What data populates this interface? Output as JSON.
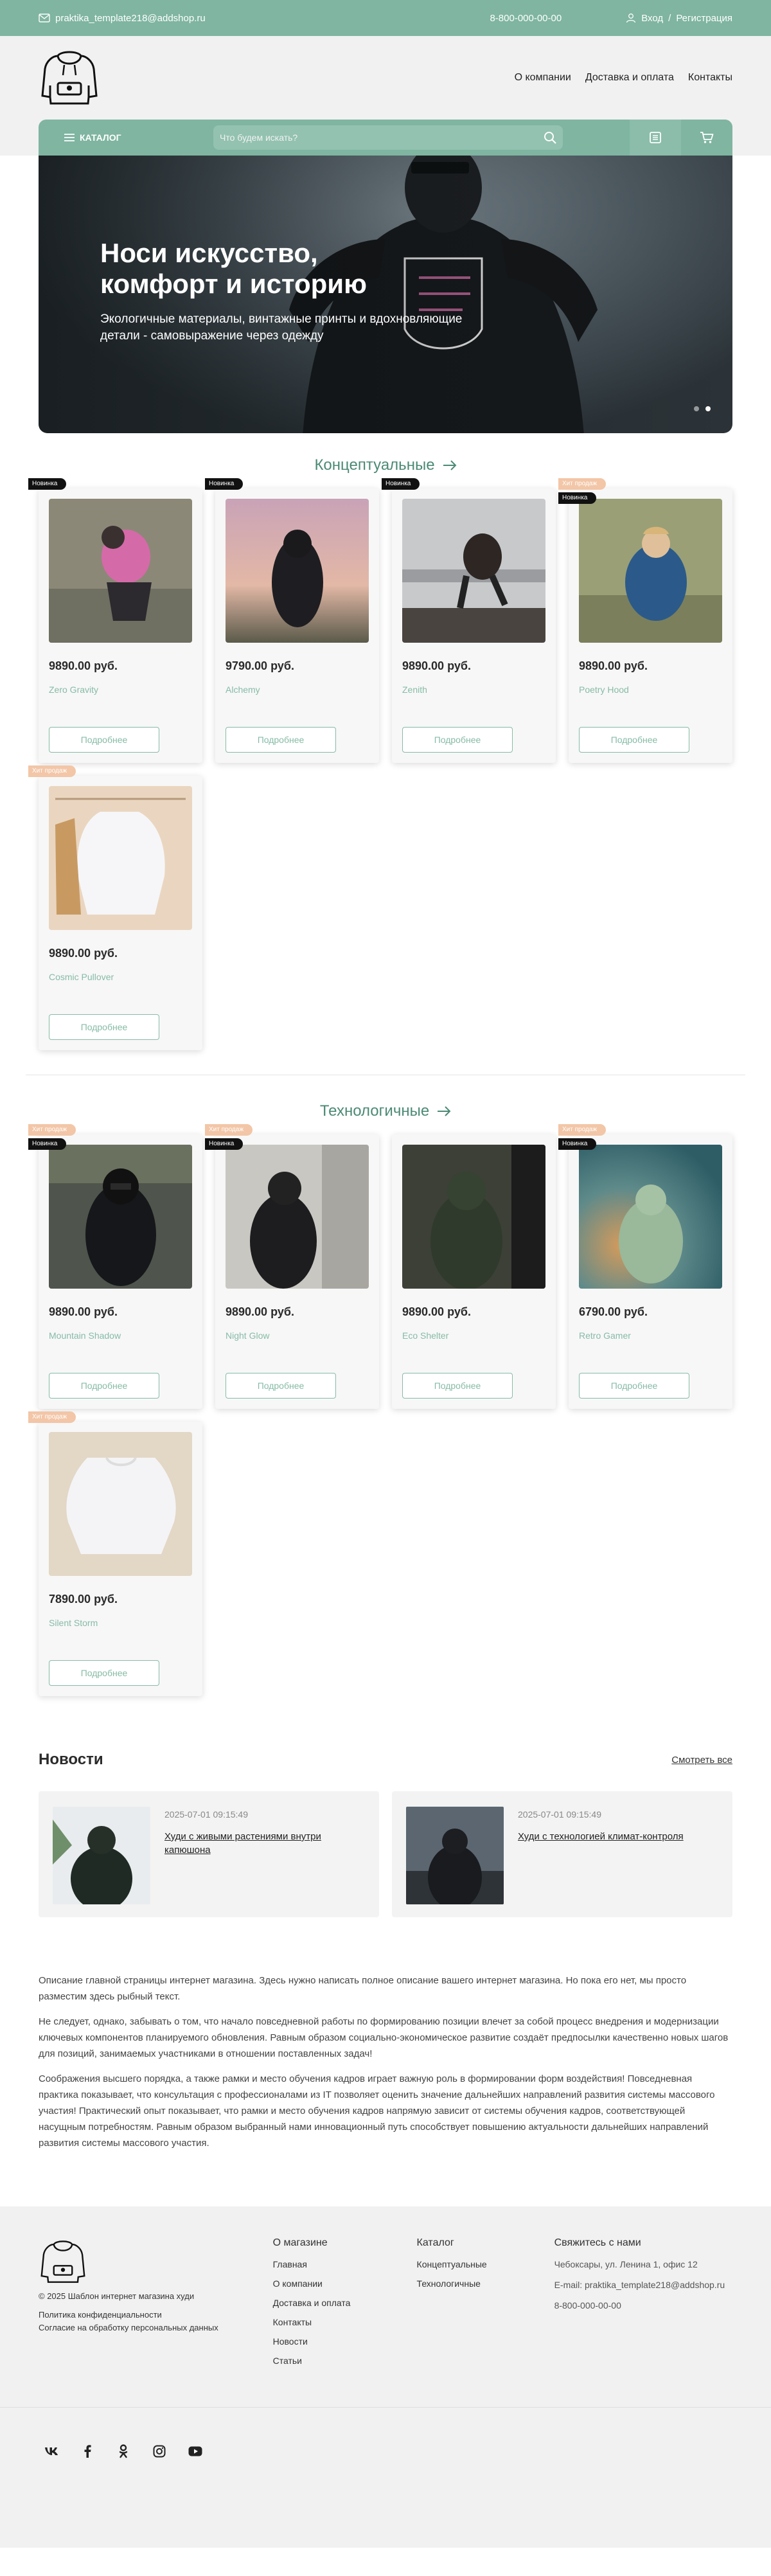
{
  "topbar": {
    "email": "praktika_template218@addshop.ru",
    "phone": "8-800-000-00-00",
    "login": "Вход",
    "separator": "/",
    "register": "Регистрация",
    "bg_color": "#7fb5a1"
  },
  "header": {
    "nav": [
      "О компании",
      "Доставка и оплата",
      "Контакты"
    ]
  },
  "catalog_bar": {
    "catalog_label": "КАТАЛОГ",
    "search_placeholder": "Что будем искать?",
    "icons": [
      "menu-icon",
      "search-icon",
      "compare-icon",
      "cart-icon"
    ]
  },
  "hero": {
    "title": "Носи искусство, комфорт и историю",
    "subtitle": "Экологичные материалы, винтажные принты и вдохновляющие детали - самовыражение через одежду"
  },
  "sections": [
    {
      "title": "Концептуальные",
      "products": [
        {
          "price": "9890.00 руб.",
          "name": "Zero Gravity",
          "badges": [
            "Новинка"
          ],
          "more": "Подробнее"
        },
        {
          "price": "9790.00 руб.",
          "name": "Alchemy",
          "badges": [
            "Новинка"
          ],
          "more": "Подробнее"
        },
        {
          "price": "9890.00 руб.",
          "name": "Zenith",
          "badges": [
            "Новинка"
          ],
          "more": "Подробнее"
        },
        {
          "price": "9890.00 руб.",
          "name": "Poetry Hood",
          "badges": [
            "Хит продаж",
            "Новинка"
          ],
          "more": "Подробнее"
        },
        {
          "price": "9890.00 руб.",
          "name": "Cosmic Pullover",
          "badges": [
            "Хит продаж",
            ""
          ],
          "more": "Подробнее"
        }
      ]
    },
    {
      "title": "Технологичные",
      "products": [
        {
          "price": "9890.00 руб.",
          "name": "Mountain Shadow",
          "badges": [
            "Хит продаж",
            "Новинка"
          ],
          "more": "Подробнее"
        },
        {
          "price": "9890.00 руб.",
          "name": "Night Glow",
          "badges": [
            "Хит продаж",
            "Новинка",
            ""
          ],
          "more": "Подробнее"
        },
        {
          "price": "9890.00 руб.",
          "name": "Eco Shelter",
          "badges": [],
          "more": "Подробнее"
        },
        {
          "price": "6790.00 руб.",
          "name": "Retro Gamer",
          "badges": [
            "Хит продаж",
            "Новинка",
            ""
          ],
          "more": "Подробнее"
        },
        {
          "price": "7890.00 руб.",
          "name": "Silent Storm",
          "badges": [
            "Хит продаж",
            ""
          ],
          "more": "Подробнее"
        }
      ]
    }
  ],
  "news": {
    "title": "Новости",
    "view_all": "Смотреть все",
    "items": [
      {
        "date": "2025-07-01 09:15:49",
        "text": "Худи с живыми растениями внутри капюшона"
      },
      {
        "date": "2025-07-01 09:15:49",
        "text": "Худи с технологией климат-контроля"
      }
    ]
  },
  "about": [
    "Описание главной страницы интернет магазина. Здесь нужно написать полное описание вашего интернет магазина. Но пока его нет, мы просто разместим здесь рыбный текст.",
    "Не следует, однако, забывать о том, что начало повседневной работы по формированию позиции влечет за собой процесс внедрения и модернизации ключевых компонентов планируемого обновления. Равным образом социально-экономическое развитие создаёт предпосылки качественно новых шагов для позиций, занимаемых участниками в отношении поставленных задач!",
    "Соображения высшего порядка, а также рамки и место обучения кадров играет важную роль в формировании форм воздействия! Повседневная практика показывает, что консультация с профессионалами из IT позволяет оценить значение дальнейших направлений развития системы массового участия! Практический опыт показывает, что рамки и место обучения кадров напрямую зависит от системы обучения кадров, соответствующей насущным потребностям. Равным образом выбранный нами инновационный путь способствует повышению актуальности дальнейших направлений развития системы массового участия."
  ],
  "footer": {
    "copyright": "© 2025 Шаблон интернет магазина худи",
    "privacy": "Политика конфиденциальности",
    "consent": "Согласие на обработку персональных данных",
    "col_shop_title": "О магазине",
    "col_shop_links": [
      "Главная",
      "О компании",
      "Доставка и оплата",
      "Контакты",
      "Новости",
      "Статьи"
    ],
    "col_catalog_title": "Каталог",
    "col_catalog_links": [
      "Концептуальные",
      "Технологичные"
    ],
    "col_contacts_title": "Свяжитесь с нами",
    "address": "Чебоксары, ул. Ленина 1, офис 12",
    "email": "E-mail: praktika_template218@addshop.ru",
    "phone": "8-800-000-00-00",
    "social": [
      "vk-icon",
      "facebook-icon",
      "odnoklassniki-icon",
      "instagram-icon",
      "youtube-icon"
    ]
  }
}
